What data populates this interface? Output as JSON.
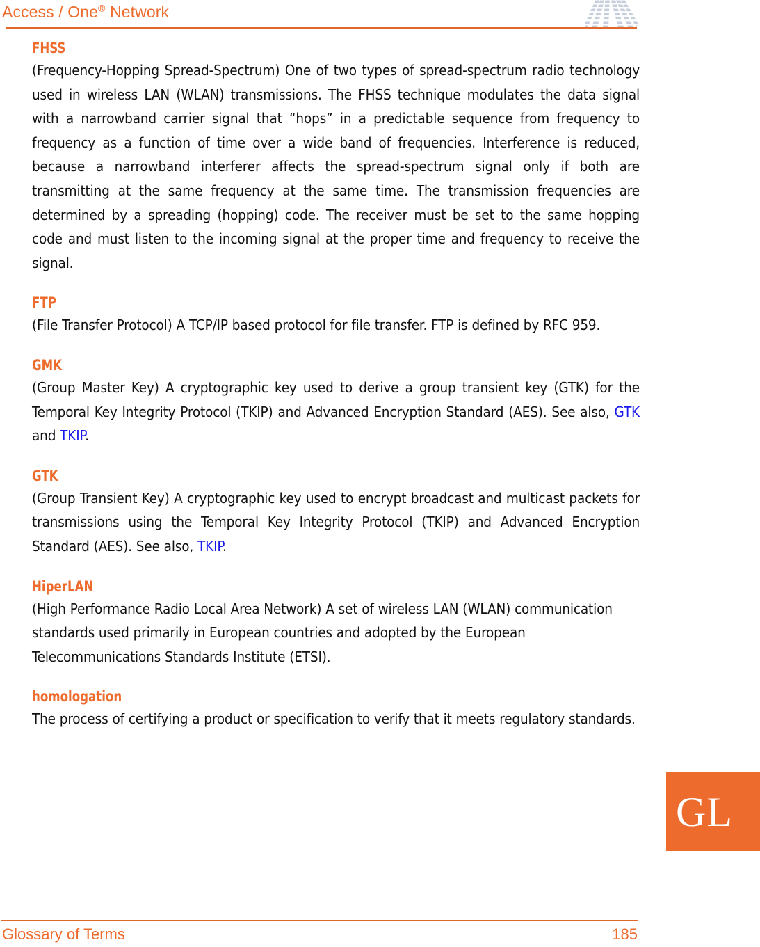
{
  "header": {
    "running_title_prefix": "Access / One",
    "running_title_sup": "®",
    "running_title_suffix": " Network",
    "logo_icon": "fan-antenna-logo-icon",
    "logo_color": "#C6CEDC",
    "rule_color": "#E2672A"
  },
  "theme": {
    "accent_orange": "#ED6C2D",
    "link_blue": "#1818EE",
    "body_text": "#111111",
    "page_background": "#FFFFFF"
  },
  "glossary": {
    "entries": [
      {
        "term": "FHSS",
        "definition": "(Frequency-Hopping Spread-Spectrum) One of two types of spread-spectrum radio technology used in wireless LAN (WLAN) transmissions. The FHSS technique modulates the data signal with a narrowband carrier signal that “hops” in a predictable sequence from frequency to frequency as a function of time over a wide band of frequencies. Interference is reduced, because a narrowband interferer affects the spread-spectrum signal only if both are transmitting at the same frequency at the same time. The transmission frequencies are determined by a spreading (hopping) code. The receiver must be set to the same hopping code and must listen to the incoming signal at the proper time and frequency to receive the signal.",
        "links": []
      },
      {
        "term": "FTP",
        "definition": "(File Transfer Protocol) A TCP/IP based protocol for file transfer. FTP is defined by RFC 959.",
        "links": []
      },
      {
        "term": "GMK",
        "definition_part_1": "(Group Master Key) A cryptographic key used to derive a group transient key (GTK) for the Temporal Key Integrity Protocol (TKIP) and Advanced Encryption Standard (AES). See also, ",
        "link_1": "GTK",
        "definition_part_2": " and ",
        "link_2": "TKIP",
        "definition_part_3": "."
      },
      {
        "term": "GTK",
        "definition_part_1": "(Group Transient Key) A cryptographic key used to encrypt broadcast and multicast packets for transmissions using the Temporal Key Integrity Protocol (TKIP) and Advanced Encryption Standard (AES). See also, ",
        "link_1": "TKIP",
        "definition_part_2": "."
      },
      {
        "term": "HiperLAN",
        "definition": "(High Performance Radio Local Area Network) A set of wireless LAN (WLAN) communication standards used primarily in European countries and adopted by the European Telecommunications Standards Institute (ETSI).",
        "links": []
      },
      {
        "term": "homologation",
        "definition": "The process of certifying a product or specification to verify that it meets regulatory standards.",
        "links": []
      }
    ]
  },
  "thumb_tab": {
    "label": "GL",
    "background_color": "#ED6C2D",
    "text_color": "#FFFFFF"
  },
  "footer": {
    "section_title": "Glossary of Terms",
    "page_number": "185",
    "rule_color": "#E2672A"
  }
}
